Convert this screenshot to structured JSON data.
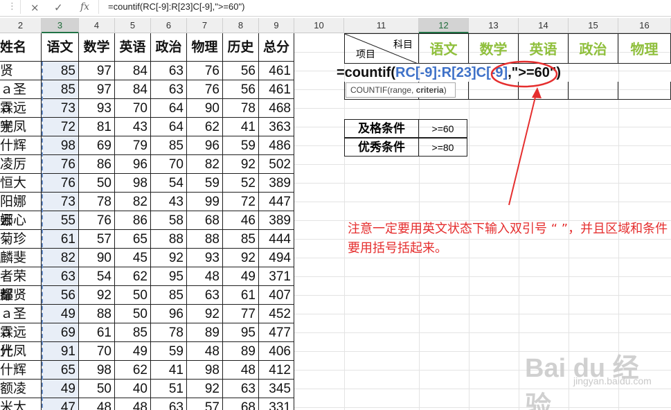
{
  "formula_bar": {
    "dots": "⋮",
    "cancel_icon": "×",
    "confirm_icon": "✓",
    "fx_label": "fx",
    "formula": "=countif(RC[-9]:R[23]C[-9],\">=60\")"
  },
  "columns": [
    "2",
    "3",
    "4",
    "5",
    "6",
    "7",
    "8",
    "9",
    "10",
    "11",
    "12",
    "13",
    "14",
    "15",
    "16"
  ],
  "score_table": {
    "headers": [
      "姓名",
      "语文",
      "数学",
      "英语",
      "政治",
      "物理",
      "历史",
      "总分"
    ],
    "rows": [
      {
        "name": "  贤",
        "scores": [
          "85",
          "97",
          "84",
          "63",
          "76",
          "56",
          "461"
        ]
      },
      {
        "name": "ａ圣霖",
        "scores": [
          "85",
          "97",
          "84",
          "63",
          "76",
          "56",
          "461"
        ]
      },
      {
        "name": "ａ远光",
        "scores": [
          "73",
          "93",
          "70",
          "64",
          "90",
          "78",
          "468"
        ]
      },
      {
        "name": "宇凤",
        "scores": [
          "72",
          "81",
          "43",
          "64",
          "62",
          "41",
          "363"
        ]
      },
      {
        "name": "什辉",
        "scores": [
          "98",
          "69",
          "79",
          "85",
          "96",
          "59",
          "486"
        ]
      },
      {
        "name": "凌厉",
        "scores": [
          "76",
          "86",
          "96",
          "70",
          "82",
          "92",
          "502"
        ]
      },
      {
        "name": "恒大",
        "scores": [
          "76",
          "50",
          "98",
          "54",
          "59",
          "52",
          "389"
        ]
      },
      {
        "name": "阳娜娜",
        "scores": [
          "73",
          "78",
          "82",
          "43",
          "99",
          "72",
          "447"
        ]
      },
      {
        "name": "云心",
        "scores": [
          "55",
          "76",
          "86",
          "58",
          "68",
          "46",
          "389"
        ]
      },
      {
        "name": "菊珍",
        "scores": [
          "61",
          "57",
          "65",
          "88",
          "88",
          "85",
          "444"
        ]
      },
      {
        "name": "麟斐",
        "scores": [
          "82",
          "90",
          "45",
          "92",
          "93",
          "92",
          "494"
        ]
      },
      {
        "name": "者荣耀",
        "scores": [
          "63",
          "54",
          "62",
          "95",
          "48",
          "49",
          "371"
        ]
      },
      {
        "name": "都贤",
        "scores": [
          "56",
          "92",
          "50",
          "85",
          "63",
          "61",
          "407"
        ]
      },
      {
        "name": "ａ圣霖",
        "scores": [
          "49",
          "88",
          "50",
          "96",
          "92",
          "77",
          "452"
        ]
      },
      {
        "name": "ａ远光",
        "scores": [
          "69",
          "61",
          "85",
          "78",
          "89",
          "95",
          "477"
        ]
      },
      {
        "name": "什凤",
        "scores": [
          "91",
          "70",
          "49",
          "59",
          "48",
          "89",
          "406"
        ]
      },
      {
        "name": "什辉",
        "scores": [
          "65",
          "98",
          "62",
          "41",
          "98",
          "48",
          "412"
        ]
      },
      {
        "name": "额凌",
        "scores": [
          "49",
          "50",
          "40",
          "51",
          "92",
          "63",
          "345"
        ]
      },
      {
        "name": "米大",
        "scores": [
          "47",
          "48",
          "48",
          "63",
          "57",
          "68",
          "331"
        ]
      }
    ]
  },
  "subject_table": {
    "corner_top": "科目",
    "corner_bottom": "项目",
    "subjects": [
      "语文",
      "数学",
      "英语",
      "政治",
      "物理"
    ]
  },
  "formula_overlay": {
    "prefix": "=countif(",
    "range": "RC[-9]:R[23]C[-9]",
    "suffix": ",\">=60\")"
  },
  "tooltip": {
    "func": "COUNTIF(range, ",
    "arg": "criteria",
    "close": ")"
  },
  "conditions": [
    {
      "label": "及格条件",
      "value": ">=60"
    },
    {
      "label": "优秀条件",
      "value": ">=80"
    }
  ],
  "note": "注意一定要用英文状态下输入双引号 “ ”，并且区域和条件要用括号括起来。",
  "watermark": {
    "brand": "Bai du 经验",
    "url": "jingyan.baidu.com"
  },
  "colors": {
    "subject_green": "#8fbf3c",
    "annotation_red": "#e52e2e",
    "ref_blue": "#3e71c8"
  }
}
